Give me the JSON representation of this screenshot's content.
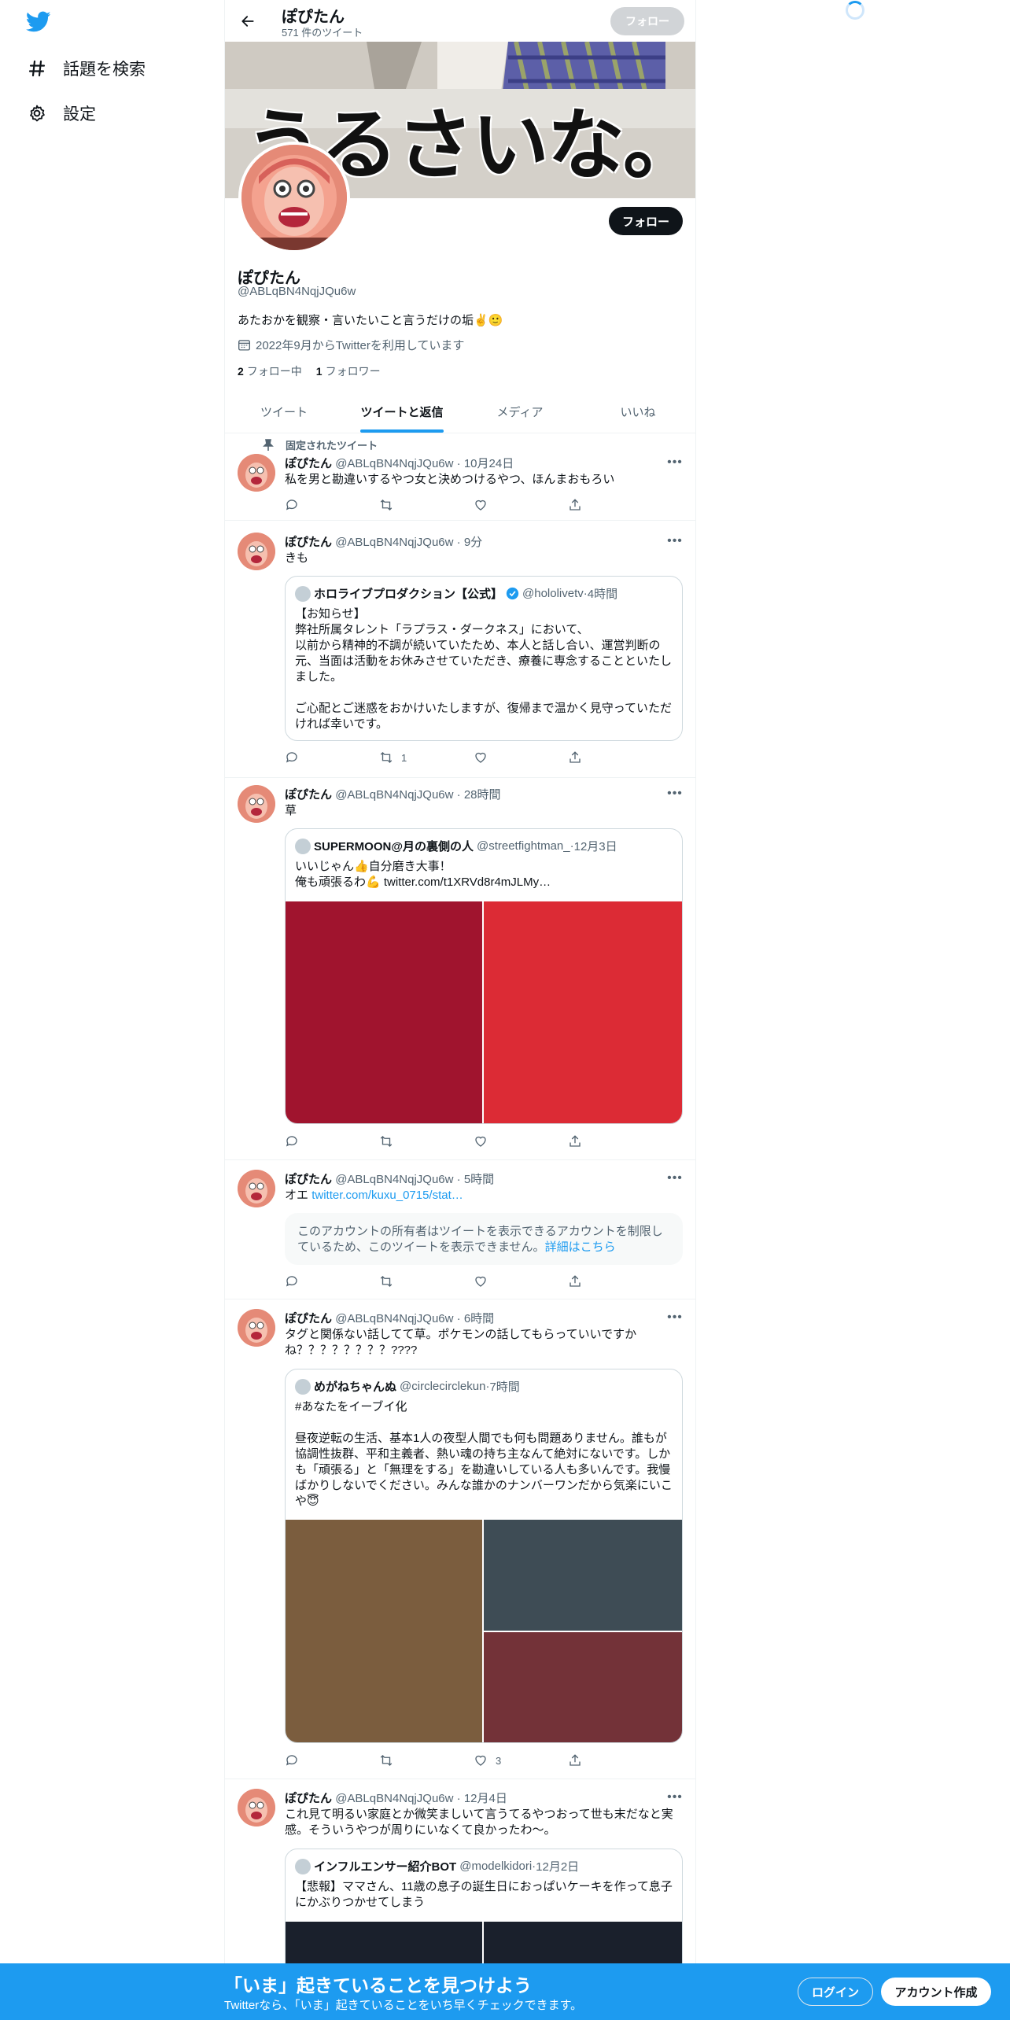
{
  "nav": {
    "logo": "twitter-bird-icon",
    "items": [
      {
        "label": "話題を検索",
        "icon": "hashtag-icon"
      },
      {
        "label": "設定",
        "icon": "gear-icon"
      }
    ]
  },
  "header": {
    "name": "ぽぴたん",
    "tweet_count": "571 件のツイート",
    "follow_label": "フォロー"
  },
  "banner": {
    "text": "うるさいな。"
  },
  "profile": {
    "name": "ぽぴたん",
    "handle": "@ABLqBN4NqjJQu6w",
    "bio": "あたおかを観察・言いたいこと言うだけの垢✌️🙂",
    "joined": "2022年9月からTwitterを利用しています",
    "following_count": "2",
    "following_label": "フォロー中",
    "followers_count": "1",
    "followers_label": "フォロワー",
    "follow_label": "フォロー"
  },
  "tabs": [
    {
      "label": "ツイート",
      "active": false
    },
    {
      "label": "ツイートと返信",
      "active": true
    },
    {
      "label": "メディア",
      "active": false
    },
    {
      "label": "いいね",
      "active": false
    }
  ],
  "pinned_label": "固定されたツイート",
  "tweets": [
    {
      "name": "ぽぴたん",
      "handle": "@ABLqBN4NqjJQu6w",
      "time": "10月24日",
      "text": "私を男と勘違いするやつ女と決めつけるやつ、ほんまおもろい",
      "retweets": "",
      "likes": ""
    },
    {
      "name": "ぽぴたん",
      "handle": "@ABLqBN4NqjJQu6w",
      "time": "9分",
      "text": "きも",
      "retweets": "1",
      "likes": "",
      "quote": {
        "name": "ホロライブプロダクション【公式】",
        "handle": "@hololivetv",
        "time": "4時間",
        "lines": [
          "【お知らせ】",
          "弊社所属タレント「ラプラス・ダークネス」において、",
          "以前から精神的不調が続いていたため、本人と話し合い、運営判断の",
          "元、当面は活動をお休みさせていただき、療養に専念することといたし",
          "ました。",
          "",
          "ご心配とご迷惑をおかけいたしますが、復帰まで温かく見守っていただ",
          "ければ幸いです。"
        ]
      }
    },
    {
      "name": "ぽぴたん",
      "handle": "@ABLqBN4NqjJQu6w",
      "time": "28時間",
      "text": "草",
      "retweets": "",
      "likes": "",
      "quote": {
        "name": "SUPERMOON@月の裏側の人",
        "handle": "@streetfightman_",
        "time": "12月3日",
        "line1": "いいじゃん👍自分磨き大事！",
        "line2_prefix": "俺も頑張るわ💪",
        "line2_link": "twitter.com/t1XRVd8r4mJLMy…"
      }
    },
    {
      "name": "ぽぴたん",
      "handle": "@ABLqBN4NqjJQu6w",
      "time": "5時間",
      "text_prefix": "オエ",
      "text_link": "twitter.com/kuxu_0715/stat…",
      "notice_text": "このアカウントの所有者はツイートを表示できるアカウントを制限しているため、このツイートを表示できません。",
      "notice_link": "詳細はこちら",
      "retweets": "",
      "likes": ""
    },
    {
      "name": "ぽぴたん",
      "handle": "@ABLqBN4NqjJQu6w",
      "time": "6時間",
      "line1": "タグと関係ない話してて草。ポケモンの話してもらっていいですか",
      "line2": "ね？？？？？？？？????",
      "retweets": "",
      "likes": "3",
      "quote": {
        "name": "めがねちゃんぬ",
        "handle": "@circlecirclekun",
        "time": "7時間",
        "lines": [
          "#あなたをイーブイ化",
          "",
          "昼夜逆転の生活、基本1人の夜型人間でも何も問題ありません。誰もが",
          "協調性抜群、平和主義者、熱い魂の持ち主なんて絶対にないです。しか",
          "も「頑張る」と「無理をする」を勘違いしている人も多いんです。我慢",
          "ばかりしないでください。みんな誰かのナンバーワンだから気楽にいこ",
          "や😇"
        ]
      }
    },
    {
      "name": "ぽぴたん",
      "handle": "@ABLqBN4NqjJQu6w",
      "time": "12月4日",
      "line1": "これ見て明るい家庭とか微笑ましいて言うてるやつおって世も末だなと実",
      "line2": "感。そういうやつが周りにいなくて良かったわ〜。",
      "quote": {
        "name": "インフルエンサー紹介BOT",
        "handle": "@modelkidori",
        "time": "12月2日",
        "line1": "【悲報】ママさん、11歳の息子の誕生日におっぱいケーキを作って息子",
        "line2": "にかぶりつかせてしまう"
      }
    }
  ],
  "bottom": {
    "title": "「いま」起きていることを見つけよう",
    "subtitle": "Twitterなら、「いま」起きていることをいち早くチェックできます。",
    "login": "ログイン",
    "signup": "アカウント作成"
  },
  "colors": {
    "accent": "#1d9bf0",
    "text": "#0f1419",
    "muted": "#536471"
  }
}
